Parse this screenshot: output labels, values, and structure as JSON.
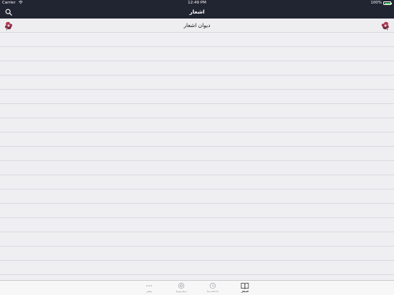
{
  "status_bar": {
    "carrier": "Carrier",
    "time": "12:49 PM",
    "battery": "100%",
    "battery_color": "#4cd964"
  },
  "navbar": {
    "title": "اشعار",
    "search_icon": "search-icon",
    "background_color": "#212431"
  },
  "list": {
    "header_title": "دیوان اشعار",
    "header_icon": "flower-ornament-icon",
    "empty_rows": 17
  },
  "tabbar": {
    "tabs": [
      {
        "label": "بیشتر",
        "icon": "more-icon",
        "active": false
      },
      {
        "label": "سفارش‌ها",
        "icon": "gear-icon",
        "active": false
      },
      {
        "label": "یادداشت‌ها",
        "icon": "clock-icon",
        "active": false
      },
      {
        "label": "اشعار",
        "icon": "book-icon",
        "active": true
      }
    ]
  }
}
